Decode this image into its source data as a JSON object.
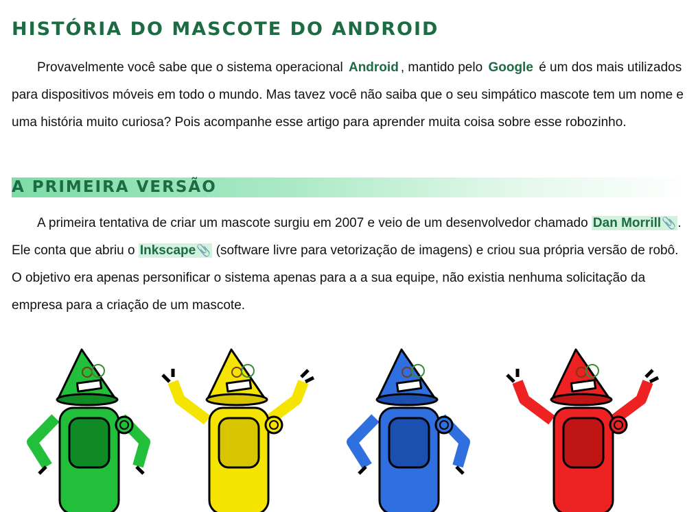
{
  "article": {
    "title": "História do Mascote do Android",
    "intro": {
      "t1": "Provavelmente você sabe que o sistema operacional",
      "android": "Android",
      "t2": ", mantido pelo",
      "google": "Google",
      "t3": "é um dos mais utilizados para dispositivos móveis em todo o mundo. Mas tavez você não saiba que o seu simpático mascote tem um nome e uma história muito curiosa? Pois acompanhe esse artigo para aprender muita coisa sobre esse robozinho."
    },
    "section1": {
      "heading": "A Primeira Versão",
      "t1": "A primeira tentativa de criar um mascote surgiu em 2007 e veio de um desenvolvedor chamado",
      "link_dan": "Dan Morrill",
      "t2": ". Ele conta que abriu o",
      "link_inkscape": "Inkscape",
      "t3": "(software livre para vetorização de imagens) e criou sua própria versão de robô. O objetivo era apenas personificar o sistema apenas para a a sua equipe, não existia nenhuma solicitação da empresa para a criação de um mascote."
    },
    "link_icon": "paperclip-icon",
    "colors": {
      "accent": "#1d6b43",
      "highlight": "#d2f2df",
      "band": "#7ddca6"
    },
    "robots": [
      {
        "color": "#22c03a",
        "dark": "#0f8a25"
      },
      {
        "color": "#f5e400",
        "dark": "#d9c400"
      },
      {
        "color": "#2f6fe0",
        "dark": "#1b4fb0"
      },
      {
        "color": "#ee2222",
        "dark": "#c01515"
      }
    ]
  }
}
